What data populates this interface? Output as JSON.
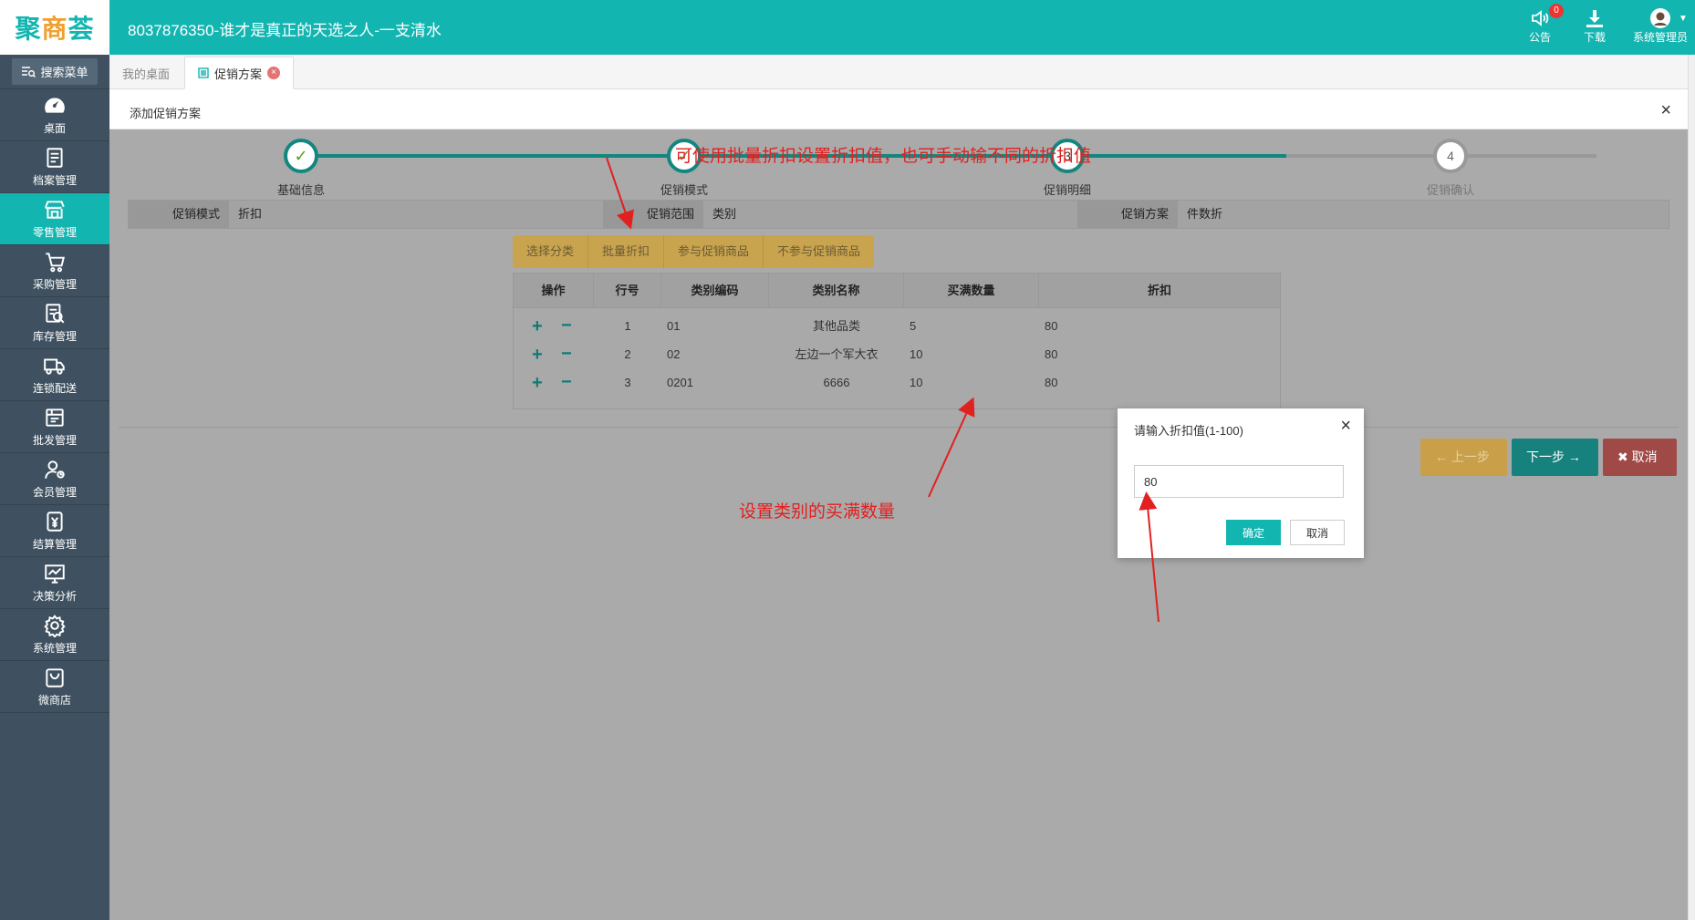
{
  "app": {
    "logo_text_1": "聚",
    "logo_text_2": "商",
    "logo_text_3": "荟",
    "title": "8037876350-谁才是真正的天选之人-一支清水"
  },
  "header": {
    "notice_label": "公告",
    "notice_count": "0",
    "download_label": "下载",
    "user_label": "系统管理员"
  },
  "sidebar": {
    "search_label": "搜索菜单",
    "items": [
      {
        "label": "桌面",
        "icon": "dashboard-icon"
      },
      {
        "label": "档案管理",
        "icon": "document-icon"
      },
      {
        "label": "零售管理",
        "icon": "store-icon"
      },
      {
        "label": "采购管理",
        "icon": "cart-icon"
      },
      {
        "label": "库存管理",
        "icon": "inventory-icon"
      },
      {
        "label": "连锁配送",
        "icon": "truck-icon"
      },
      {
        "label": "批发管理",
        "icon": "wholesale-icon"
      },
      {
        "label": "会员管理",
        "icon": "member-icon"
      },
      {
        "label": "结算管理",
        "icon": "settlement-icon"
      },
      {
        "label": "决策分析",
        "icon": "chart-icon"
      },
      {
        "label": "系统管理",
        "icon": "gear-icon"
      },
      {
        "label": "微商店",
        "icon": "shop-icon"
      }
    ]
  },
  "tabs": {
    "home": "我的桌面",
    "current": "促销方案",
    "close": "×"
  },
  "panel": {
    "title": "添加促销方案",
    "close": "×"
  },
  "steps": [
    {
      "label": "基础信息",
      "mark": "✓"
    },
    {
      "label": "促销模式",
      "mark": "✓"
    },
    {
      "label": "促销明细",
      "mark": "3"
    },
    {
      "label": "促销确认",
      "mark": "4"
    }
  ],
  "info": {
    "mode_label": "促销模式",
    "mode_value": "折扣",
    "scope_label": "促销范围",
    "scope_value": "类别",
    "plan_label": "促销方案",
    "plan_value": "件数折"
  },
  "toolbar": {
    "select_category": "选择分类",
    "batch_discount": "批量折扣",
    "include_goods": "参与促销商品",
    "exclude_goods": "不参与促销商品"
  },
  "table": {
    "columns": [
      "操作",
      "行号",
      "类别编码",
      "类别名称",
      "买满数量",
      "折扣"
    ],
    "rows": [
      {
        "no": "1",
        "code": "01",
        "name": "其他品类",
        "qty": "5",
        "discount": "80"
      },
      {
        "no": "2",
        "code": "02",
        "name": "左边一个军大衣",
        "qty": "10",
        "discount": "80"
      },
      {
        "no": "3",
        "code": "0201",
        "name": "6666",
        "qty": "10",
        "discount": "80"
      }
    ],
    "plus": "+",
    "minus": "−"
  },
  "buttons": {
    "prev": "上一步",
    "next": "下一步",
    "cancel": "取消"
  },
  "annotations": {
    "top": "可使用批量折扣设置折扣值，也可手动输不同的折扣值",
    "middle": "设置类别的买满数量"
  },
  "dialog": {
    "title": "请输入折扣值(1-100)",
    "close": "×",
    "value": "80",
    "ok": "确定",
    "cancel": "取消"
  },
  "colors": {
    "brand": "#13b5b1",
    "annotation": "#e12020"
  }
}
